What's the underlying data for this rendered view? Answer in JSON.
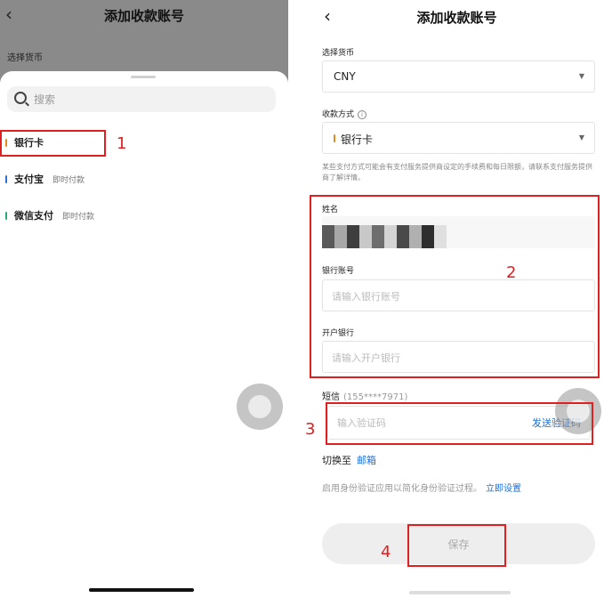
{
  "left": {
    "title": "添加收款账号",
    "back": "‹",
    "currency_label": "选择货币",
    "search_placeholder": "搜索",
    "methods": [
      {
        "name": "银行卡",
        "note": "",
        "color": "#e08a1e"
      },
      {
        "name": "支付宝",
        "note": "即时付款",
        "color": "#2b6fd6"
      },
      {
        "name": "微信支付",
        "note": "即时付款",
        "color": "#2aa876"
      }
    ]
  },
  "right": {
    "title": "添加收款账号",
    "back": "‹",
    "currency_label": "选择货币",
    "currency_value": "CNY",
    "method_label": "收款方式",
    "method_value": "银行卡",
    "note": "某些支付方式可能会有支付服务提供商设定的手续费和每日限额，请联系支付服务提供商了解详情。",
    "name_label": "姓名",
    "account_label": "银行账号",
    "account_placeholder": "请输入银行账号",
    "bank_label": "开户银行",
    "bank_placeholder": "请输入开户银行",
    "sms_label": "短信",
    "sms_phone": "(155****7971)",
    "code_placeholder": "输入验证码",
    "send_code": "发送验证码",
    "switch_label": "切换至",
    "switch_link": "邮箱",
    "identity_text": "启用身份验证应用以简化身份验证过程。",
    "identity_link": "立即设置",
    "save_label": "保存"
  },
  "annotations": [
    "1",
    "2",
    "3",
    "4"
  ]
}
